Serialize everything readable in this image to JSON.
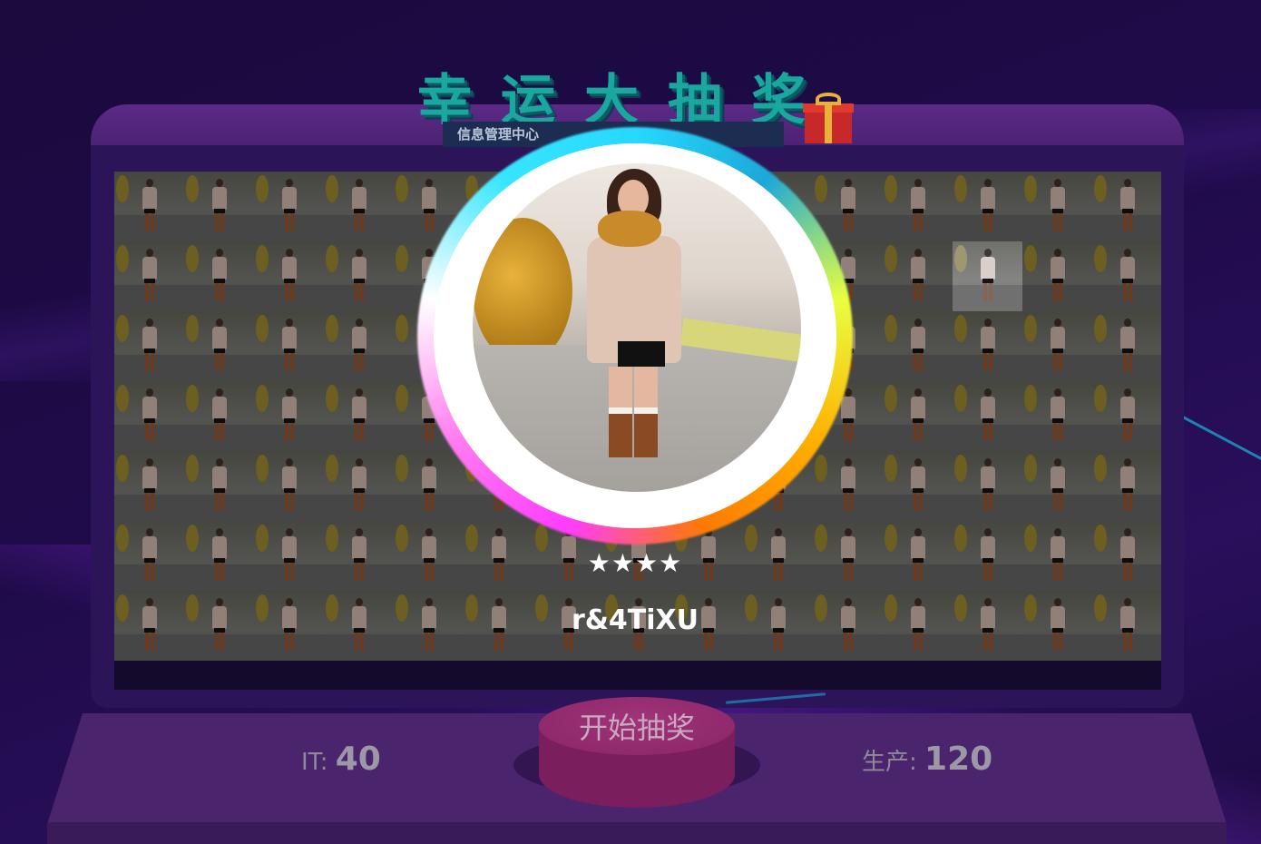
{
  "title": {
    "chars": [
      "幸",
      "运",
      "大",
      "抽",
      "奖"
    ],
    "subtitle": "信息管理中心"
  },
  "winner": {
    "stars": "★★★★",
    "name": "r&4TiXU"
  },
  "grid": {
    "rows": 7,
    "cols": 15,
    "highlight": {
      "row": 1,
      "col": 12
    }
  },
  "start_button": {
    "label": "开始抽奖"
  },
  "stats": {
    "left": {
      "label": "IT:",
      "value": "40"
    },
    "right": {
      "label": "生产:",
      "value": "120"
    }
  },
  "colors": {
    "accent": "#1aa7a0",
    "button": "#8a2468",
    "background": "#1f0b4a"
  }
}
